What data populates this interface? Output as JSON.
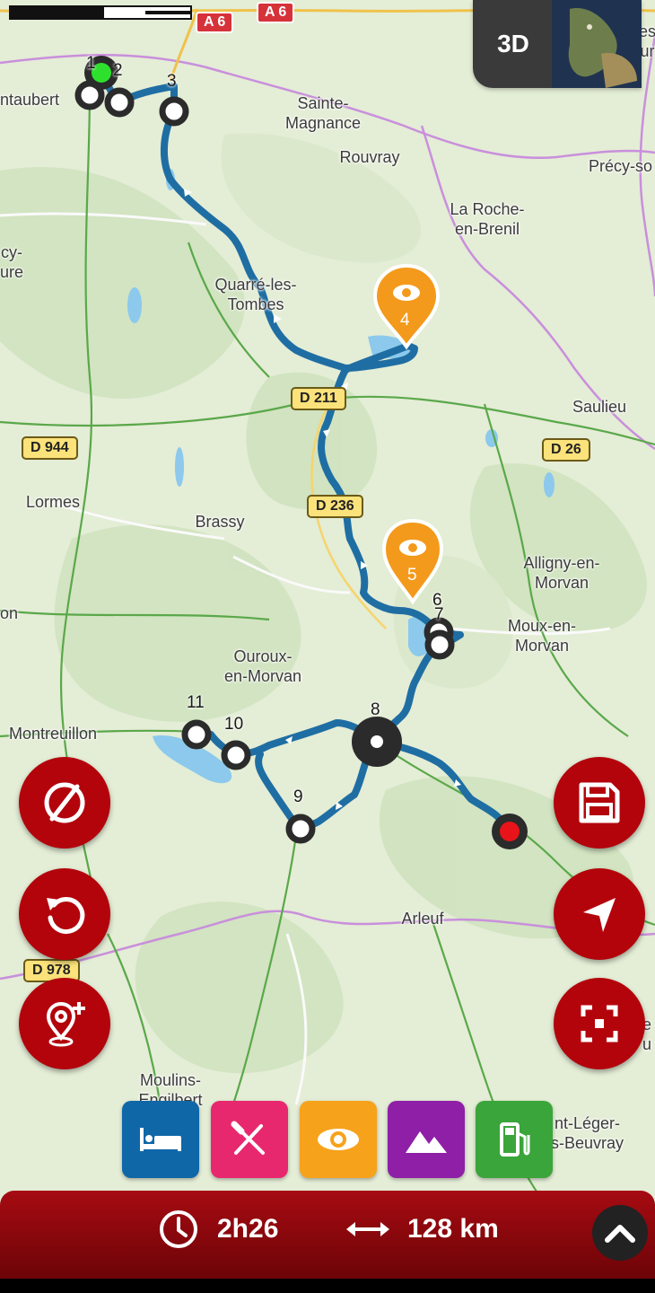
{
  "map": {
    "places": [
      {
        "name": "Sainte-\nMagnance",
        "id": "sainte-magnance"
      },
      {
        "name": "Rouvray",
        "id": "rouvray"
      },
      {
        "name": "Précy-so",
        "id": "precy"
      },
      {
        "name": "La Roche-\nen-Brenil",
        "id": "la-roche"
      },
      {
        "name": "Quarré-les-\nTombes",
        "id": "quarre"
      },
      {
        "name": "Saulieu",
        "id": "saulieu"
      },
      {
        "name": "Lormes",
        "id": "lormes"
      },
      {
        "name": "Brassy",
        "id": "brassy"
      },
      {
        "name": "Alligny-en-\nMorvan",
        "id": "alligny"
      },
      {
        "name": "Moux-en-\nMorvan",
        "id": "moux"
      },
      {
        "name": "Ouroux-\nen-Morvan",
        "id": "ouroux"
      },
      {
        "name": "Montreuillon",
        "id": "montreuillon"
      },
      {
        "name": "Arleuf",
        "id": "arleuf"
      },
      {
        "name": "Moulins-\nEngilbert",
        "id": "moulins"
      },
      {
        "name": "nt-Léger-\ns-Beuvray",
        "id": "saint-leger"
      },
      {
        "name": "ntaubert",
        "id": "montaubert"
      },
      {
        "name": "cy-\nure",
        "id": "edge-left-1"
      },
      {
        "name": "on",
        "id": "edge-left-2"
      },
      {
        "name": "es\nur",
        "id": "edge-right-1"
      },
      {
        "name": "e\nu",
        "id": "edge-right-2"
      }
    ],
    "roads": [
      {
        "label": "D 211",
        "id": "d211"
      },
      {
        "label": "D 944",
        "id": "d944"
      },
      {
        "label": "D 236",
        "id": "d236"
      },
      {
        "label": "D 26",
        "id": "d26"
      },
      {
        "label": "D 978",
        "id": "d978"
      }
    ],
    "motorways": [
      {
        "label": "A 6",
        "id": "a6-1"
      },
      {
        "label": "A 6",
        "id": "a6-2"
      }
    ],
    "waypoints": [
      "1",
      "2",
      "3",
      "6",
      "7",
      "8",
      "9",
      "10",
      "11"
    ],
    "poi_markers": [
      {
        "number": "4",
        "icon": "eye-icon",
        "color": "#f39a1c"
      },
      {
        "number": "5",
        "icon": "eye-icon",
        "color": "#f39a1c"
      }
    ],
    "route_color": "#1f6ea3",
    "start_color": "#2ee02e",
    "end_color": "#e8141a"
  },
  "view_toggle": {
    "label": "3D"
  },
  "left_buttons": [
    {
      "name": "hide-route-button",
      "icon": "no-entry-icon"
    },
    {
      "name": "undo-button",
      "icon": "undo-icon"
    },
    {
      "name": "add-waypoint-button",
      "icon": "add-location-icon"
    }
  ],
  "right_buttons": [
    {
      "name": "save-button",
      "icon": "floppy-disk-icon"
    },
    {
      "name": "navigate-button",
      "icon": "navigation-arrow-icon"
    },
    {
      "name": "recenter-button",
      "icon": "focus-icon"
    }
  ],
  "categories": [
    {
      "name": "hotel",
      "icon": "bed-icon",
      "color": "#0f67a8"
    },
    {
      "name": "restaurant",
      "icon": "cutlery-icon",
      "color": "#e8286e"
    },
    {
      "name": "sightseeing",
      "icon": "eye-icon",
      "color": "#f7a21b"
    },
    {
      "name": "mountain",
      "icon": "mountain-icon",
      "color": "#8e1fa6"
    },
    {
      "name": "fuel",
      "icon": "fuel-icon",
      "color": "#3aa53a"
    }
  ],
  "summary": {
    "duration": "2h26",
    "distance": "128 km"
  }
}
